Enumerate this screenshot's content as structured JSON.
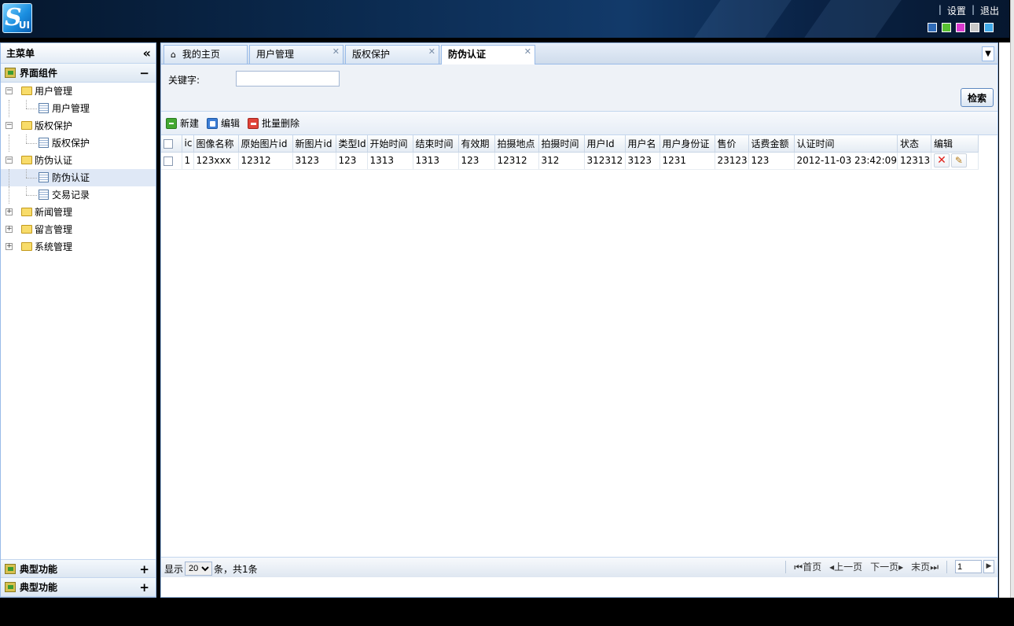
{
  "header": {
    "links": [
      "设置",
      "退出"
    ],
    "logo_text": "UI",
    "theme_colors": [
      "#2f6bb8",
      "#58c032",
      "#d93ad0",
      "#c8c8c8",
      "#3fa8e8"
    ]
  },
  "sidebar": {
    "title": "主菜单",
    "collapse_icon": "double-chevron-left-icon",
    "sections": [
      {
        "label": "界面组件",
        "toggle": "−"
      },
      {
        "label": "典型功能",
        "toggle": "+"
      },
      {
        "label": "典型功能",
        "toggle": "+"
      }
    ],
    "tree": [
      {
        "label": "用户管理",
        "level": 1,
        "type": "folder",
        "expanded": true
      },
      {
        "label": "用户管理",
        "level": 2,
        "type": "page"
      },
      {
        "label": "版权保护",
        "level": 1,
        "type": "folder",
        "expanded": true
      },
      {
        "label": "版权保护",
        "level": 2,
        "type": "page"
      },
      {
        "label": "防伪认证",
        "level": 1,
        "type": "folder",
        "expanded": true
      },
      {
        "label": "防伪认证",
        "level": 2,
        "type": "page",
        "selected": true
      },
      {
        "label": "交易记录",
        "level": 2,
        "type": "page"
      },
      {
        "label": "新闻管理",
        "level": 1,
        "type": "folder",
        "expanded": false
      },
      {
        "label": "留言管理",
        "level": 1,
        "type": "folder",
        "expanded": false
      },
      {
        "label": "系统管理",
        "level": 1,
        "type": "folder",
        "expanded": false
      }
    ]
  },
  "tabs": [
    {
      "label": "我的主页",
      "icon": "home-icon",
      "closable": false
    },
    {
      "label": "用户管理",
      "closable": true
    },
    {
      "label": "版权保护",
      "closable": true
    },
    {
      "label": "防伪认证",
      "closable": true,
      "active": true
    }
  ],
  "search": {
    "label": "关键字:",
    "value": "",
    "button": "检索"
  },
  "toolbar": {
    "new": "新建",
    "edit": "编辑",
    "batch_delete": "批量删除"
  },
  "grid": {
    "columns": [
      "ic",
      "图像名称",
      "原始图片id",
      "新图片id",
      "类型Id",
      "开始时间",
      "结束时间",
      "有效期",
      "拍摄地点",
      "拍摄时间",
      "用户Id",
      "用户名",
      "用户身份证",
      "售价",
      "话费金额",
      "认证时间",
      "状态",
      "编辑"
    ],
    "rows": [
      [
        "1",
        "123xxx",
        "12312",
        "3123",
        "123",
        "1313",
        "1313",
        "123",
        "12312",
        "312",
        "312312",
        "3123",
        "1231",
        "23123",
        "123",
        "2012-11-03 23:42:09",
        "12313"
      ]
    ]
  },
  "pager": {
    "show_label": "显示",
    "page_size": "20",
    "summary": "条，共1条",
    "first": "首页",
    "prev": "上一页",
    "next": "下一页",
    "last": "末页",
    "page": "1"
  }
}
